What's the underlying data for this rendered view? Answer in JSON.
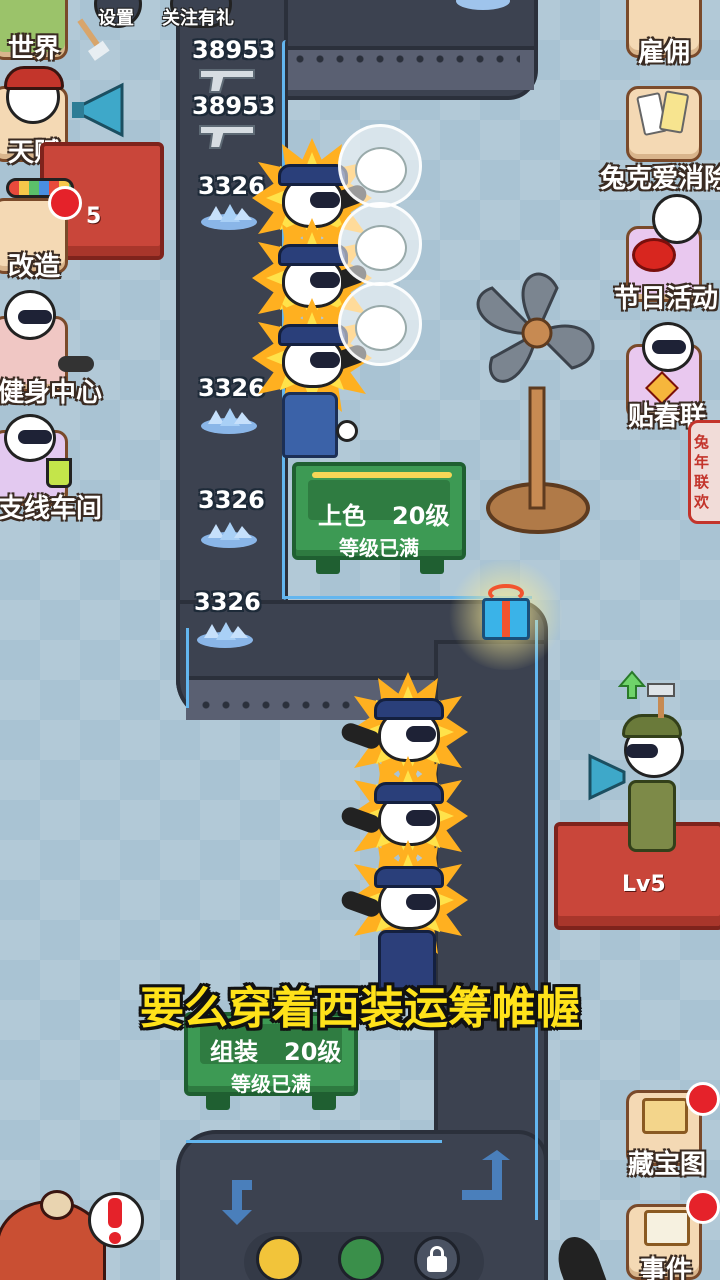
{
  "top_bar": {
    "settings_label": "设置",
    "follow_reward_label": "关注有礼"
  },
  "left_menu": [
    {
      "label": "世界",
      "icon": "map-icon"
    },
    {
      "label": "天赋",
      "icon": "megaphone-bunny-icon"
    },
    {
      "label": "改造",
      "icon": "paint-roller-icon",
      "badge": true
    },
    {
      "label": "健身中心",
      "icon": "dumbbell-bunny-icon"
    },
    {
      "label": "支线车间",
      "icon": "juice-bunny-icon"
    }
  ],
  "left_platform_level_partial": "5",
  "right_menu": [
    {
      "label": "雇佣",
      "icon": "hire-icon"
    },
    {
      "label": "兔克爱消除",
      "icon": "cards-icon"
    },
    {
      "label": "节日活动",
      "icon": "lantern-bunny-icon"
    },
    {
      "label": "贴春联",
      "icon": "couplet-bunny-icon"
    },
    {
      "label": "藏宝图",
      "icon": "treasure-map-icon",
      "badge": true
    },
    {
      "label": "事件",
      "icon": "event-scroll-icon",
      "badge": true
    }
  ],
  "side_tab_label": "兔年联欢",
  "counters": {
    "gun_1": "38953",
    "gun_2": "38953",
    "gem_1": "3326",
    "gem_2": "3326",
    "gem_3": "3326",
    "gem_4": "3326"
  },
  "machines": [
    {
      "name": "上色",
      "level": "20级",
      "status": "等级已满"
    },
    {
      "name": "组装",
      "level": "20级",
      "status": "等级已满"
    }
  ],
  "right_platform_level": "Lv5",
  "subtitle": "要么穿着西装运筹帷幄",
  "colors": {
    "belt": "#3c4250",
    "machine": "#3d9a54",
    "subtitle": "#ffe21a",
    "platform": "#c9463a"
  }
}
